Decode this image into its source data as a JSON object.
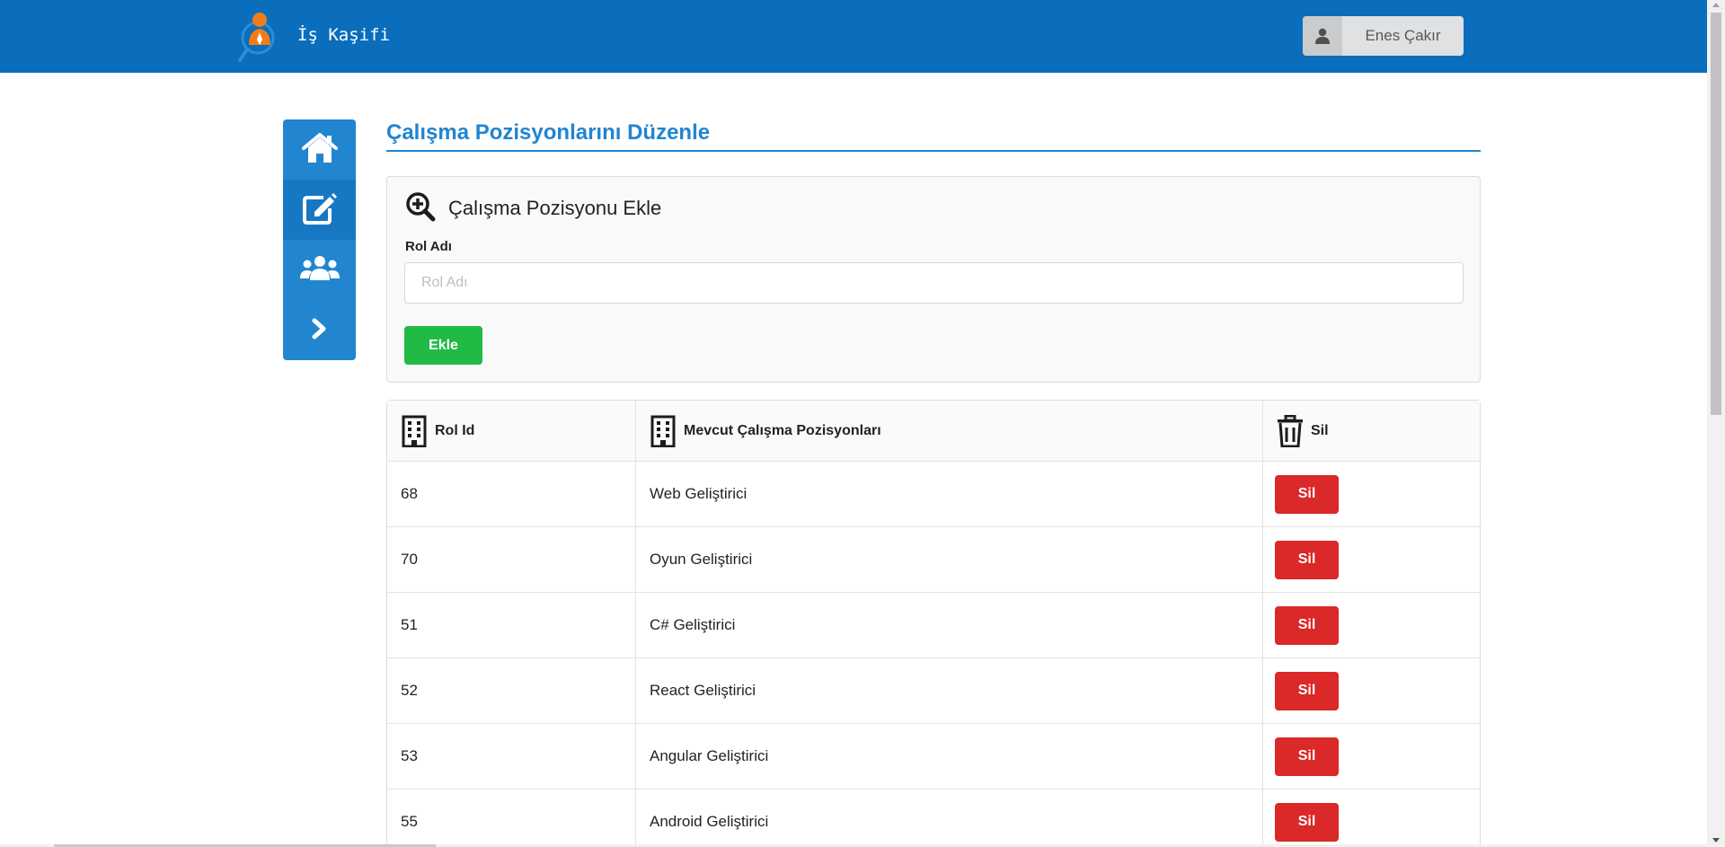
{
  "header": {
    "brand": "İş Kaşifi",
    "user_name": "Enes Çakır"
  },
  "sidebar": {
    "items": [
      {
        "icon": "home-icon",
        "active": false
      },
      {
        "icon": "edit-icon",
        "active": true
      },
      {
        "icon": "users-icon",
        "active": false
      },
      {
        "icon": "chevron-right-icon",
        "active": false
      }
    ]
  },
  "page": {
    "title": "Çalışma Pozisyonlarını Düzenle"
  },
  "add_form": {
    "heading": "Çalışma Pozisyonu Ekle",
    "field_label": "Rol Adı",
    "field_placeholder": "Rol Adı",
    "field_value": "",
    "submit_label": "Ekle"
  },
  "table": {
    "headers": {
      "id": "Rol Id",
      "name": "Mevcut Çalışma Pozisyonları",
      "delete": "Sil"
    },
    "delete_label": "Sil",
    "rows": [
      {
        "id": "68",
        "name": "Web Geliştirici"
      },
      {
        "id": "70",
        "name": "Oyun Geliştirici"
      },
      {
        "id": "51",
        "name": "C# Geliştirici"
      },
      {
        "id": "52",
        "name": "React Geliştirici"
      },
      {
        "id": "53",
        "name": "Angular Geliştirici"
      },
      {
        "id": "55",
        "name": "Android Geliştirici"
      }
    ]
  },
  "colors": {
    "header_bg": "#0a6ebd",
    "primary": "#2185d0",
    "success": "#21ba45",
    "danger": "#db2828"
  }
}
